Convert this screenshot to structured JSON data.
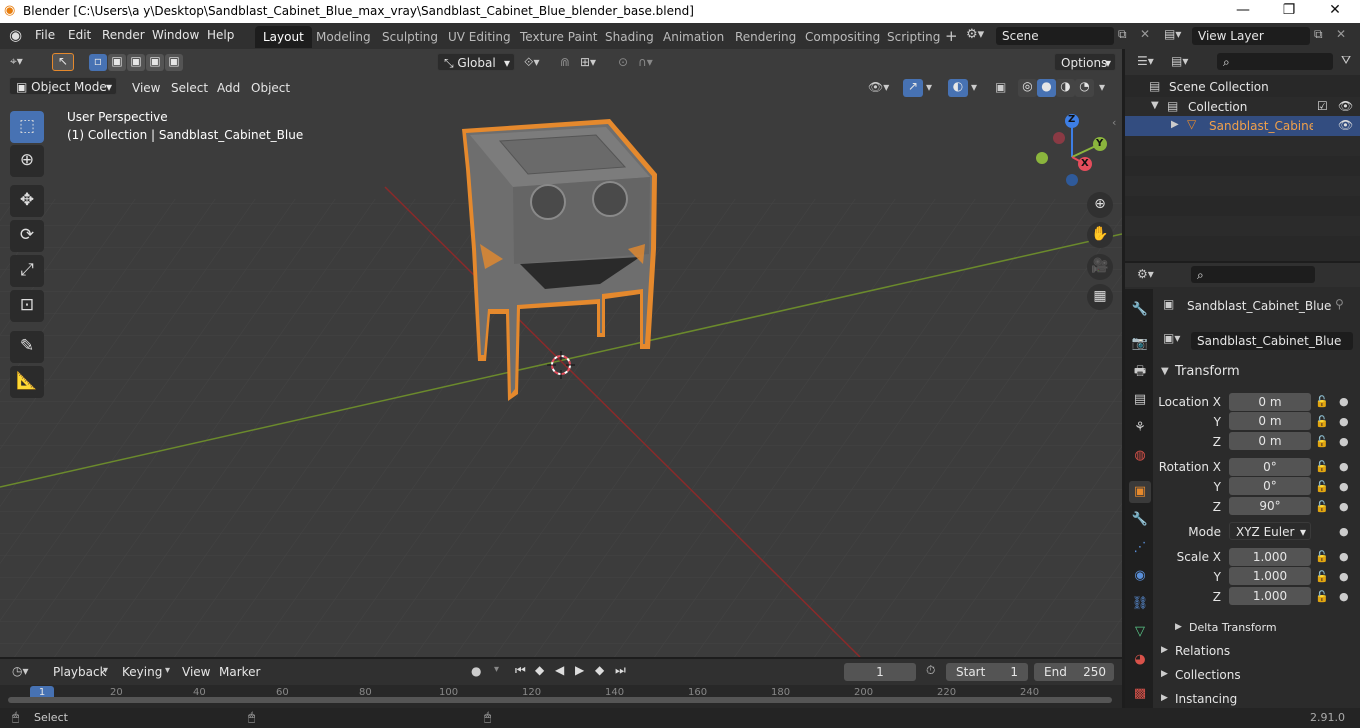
{
  "window": {
    "title": "Blender [C:\\Users\\a y\\Desktop\\Sandblast_Cabinet_Blue_max_vray\\Sandblast_Cabinet_Blue_blender_base.blend]",
    "controls": [
      "—",
      "❐",
      "✕"
    ]
  },
  "menu": [
    "File",
    "Edit",
    "Render",
    "Window",
    "Help"
  ],
  "workspaces": [
    "Layout",
    "Modeling",
    "Sculpting",
    "UV Editing",
    "Texture Paint",
    "Shading",
    "Animation",
    "Rendering",
    "Compositing",
    "Scripting"
  ],
  "active_workspace": "Layout",
  "scene": "Scene",
  "view_layer": "View Layer",
  "viewport": {
    "transform_orientation": "Global",
    "options": "Options",
    "mode": "Object Mode",
    "menus": [
      "View",
      "Select",
      "Add",
      "Object"
    ],
    "perspective_label": "User Perspective",
    "collection_label": "(1) Collection | Sandblast_Cabinet_Blue",
    "gizmo": {
      "x": "X",
      "y": "Y",
      "z": "Z"
    }
  },
  "outliner": {
    "items": [
      {
        "label": "Scene Collection"
      },
      {
        "label": "Collection"
      },
      {
        "label": "Sandblast_Cabinet_B"
      }
    ]
  },
  "properties": {
    "object_name": "Sandblast_Cabinet_Blue",
    "data_name": "Sandblast_Cabinet_Blue",
    "transform_header": "Transform",
    "location": {
      "label": "Location X",
      "x": "0 m",
      "y": "0 m",
      "z": "0 m"
    },
    "rotation": {
      "label": "Rotation X",
      "x": "0°",
      "y": "0°",
      "z": "90°"
    },
    "axis_labels": {
      "y": "Y",
      "z": "Z"
    },
    "mode_label": "Mode",
    "mode_value": "XYZ Euler",
    "scale": {
      "label": "Scale X",
      "x": "1.000",
      "y": "1.000",
      "z": "1.000"
    },
    "delta": "Delta Transform",
    "sections": [
      "Relations",
      "Collections",
      "Instancing"
    ]
  },
  "timeline": {
    "menus": [
      "Playback",
      "Keying",
      "View",
      "Marker"
    ],
    "current_frame": "1",
    "start_label": "Start",
    "start": "1",
    "end_label": "End",
    "end": "250",
    "ruler_labels": [
      "1",
      "20",
      "40",
      "60",
      "80",
      "100",
      "120",
      "140",
      "160",
      "180",
      "200",
      "220",
      "240"
    ]
  },
  "status": {
    "left": "Select",
    "version": "2.91.0"
  },
  "colors": {
    "accent": "#4772b3",
    "selection_outline": "#e5892d",
    "x_axis": "#e54d5c",
    "y_axis": "#8bb53d",
    "z_axis": "#3d7ee5"
  }
}
